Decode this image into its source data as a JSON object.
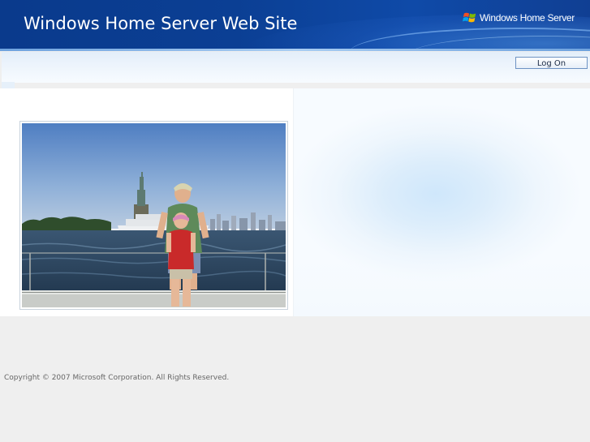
{
  "header": {
    "title": "Windows Home Server Web Site",
    "brand_text": "Windows Home Server",
    "brand_logo": "windows-flag-icon"
  },
  "toolbar": {
    "logon_label": "Log On"
  },
  "photo": {
    "subject": "photo-statue-of-liberty"
  },
  "footer": {
    "copyright": "Copyright © 2007 Microsoft Corporation. All Rights Reserved."
  },
  "colors": {
    "header_blue": "#0b3f94",
    "page_bg": "#efefef",
    "button_border": "#6e93c3"
  }
}
